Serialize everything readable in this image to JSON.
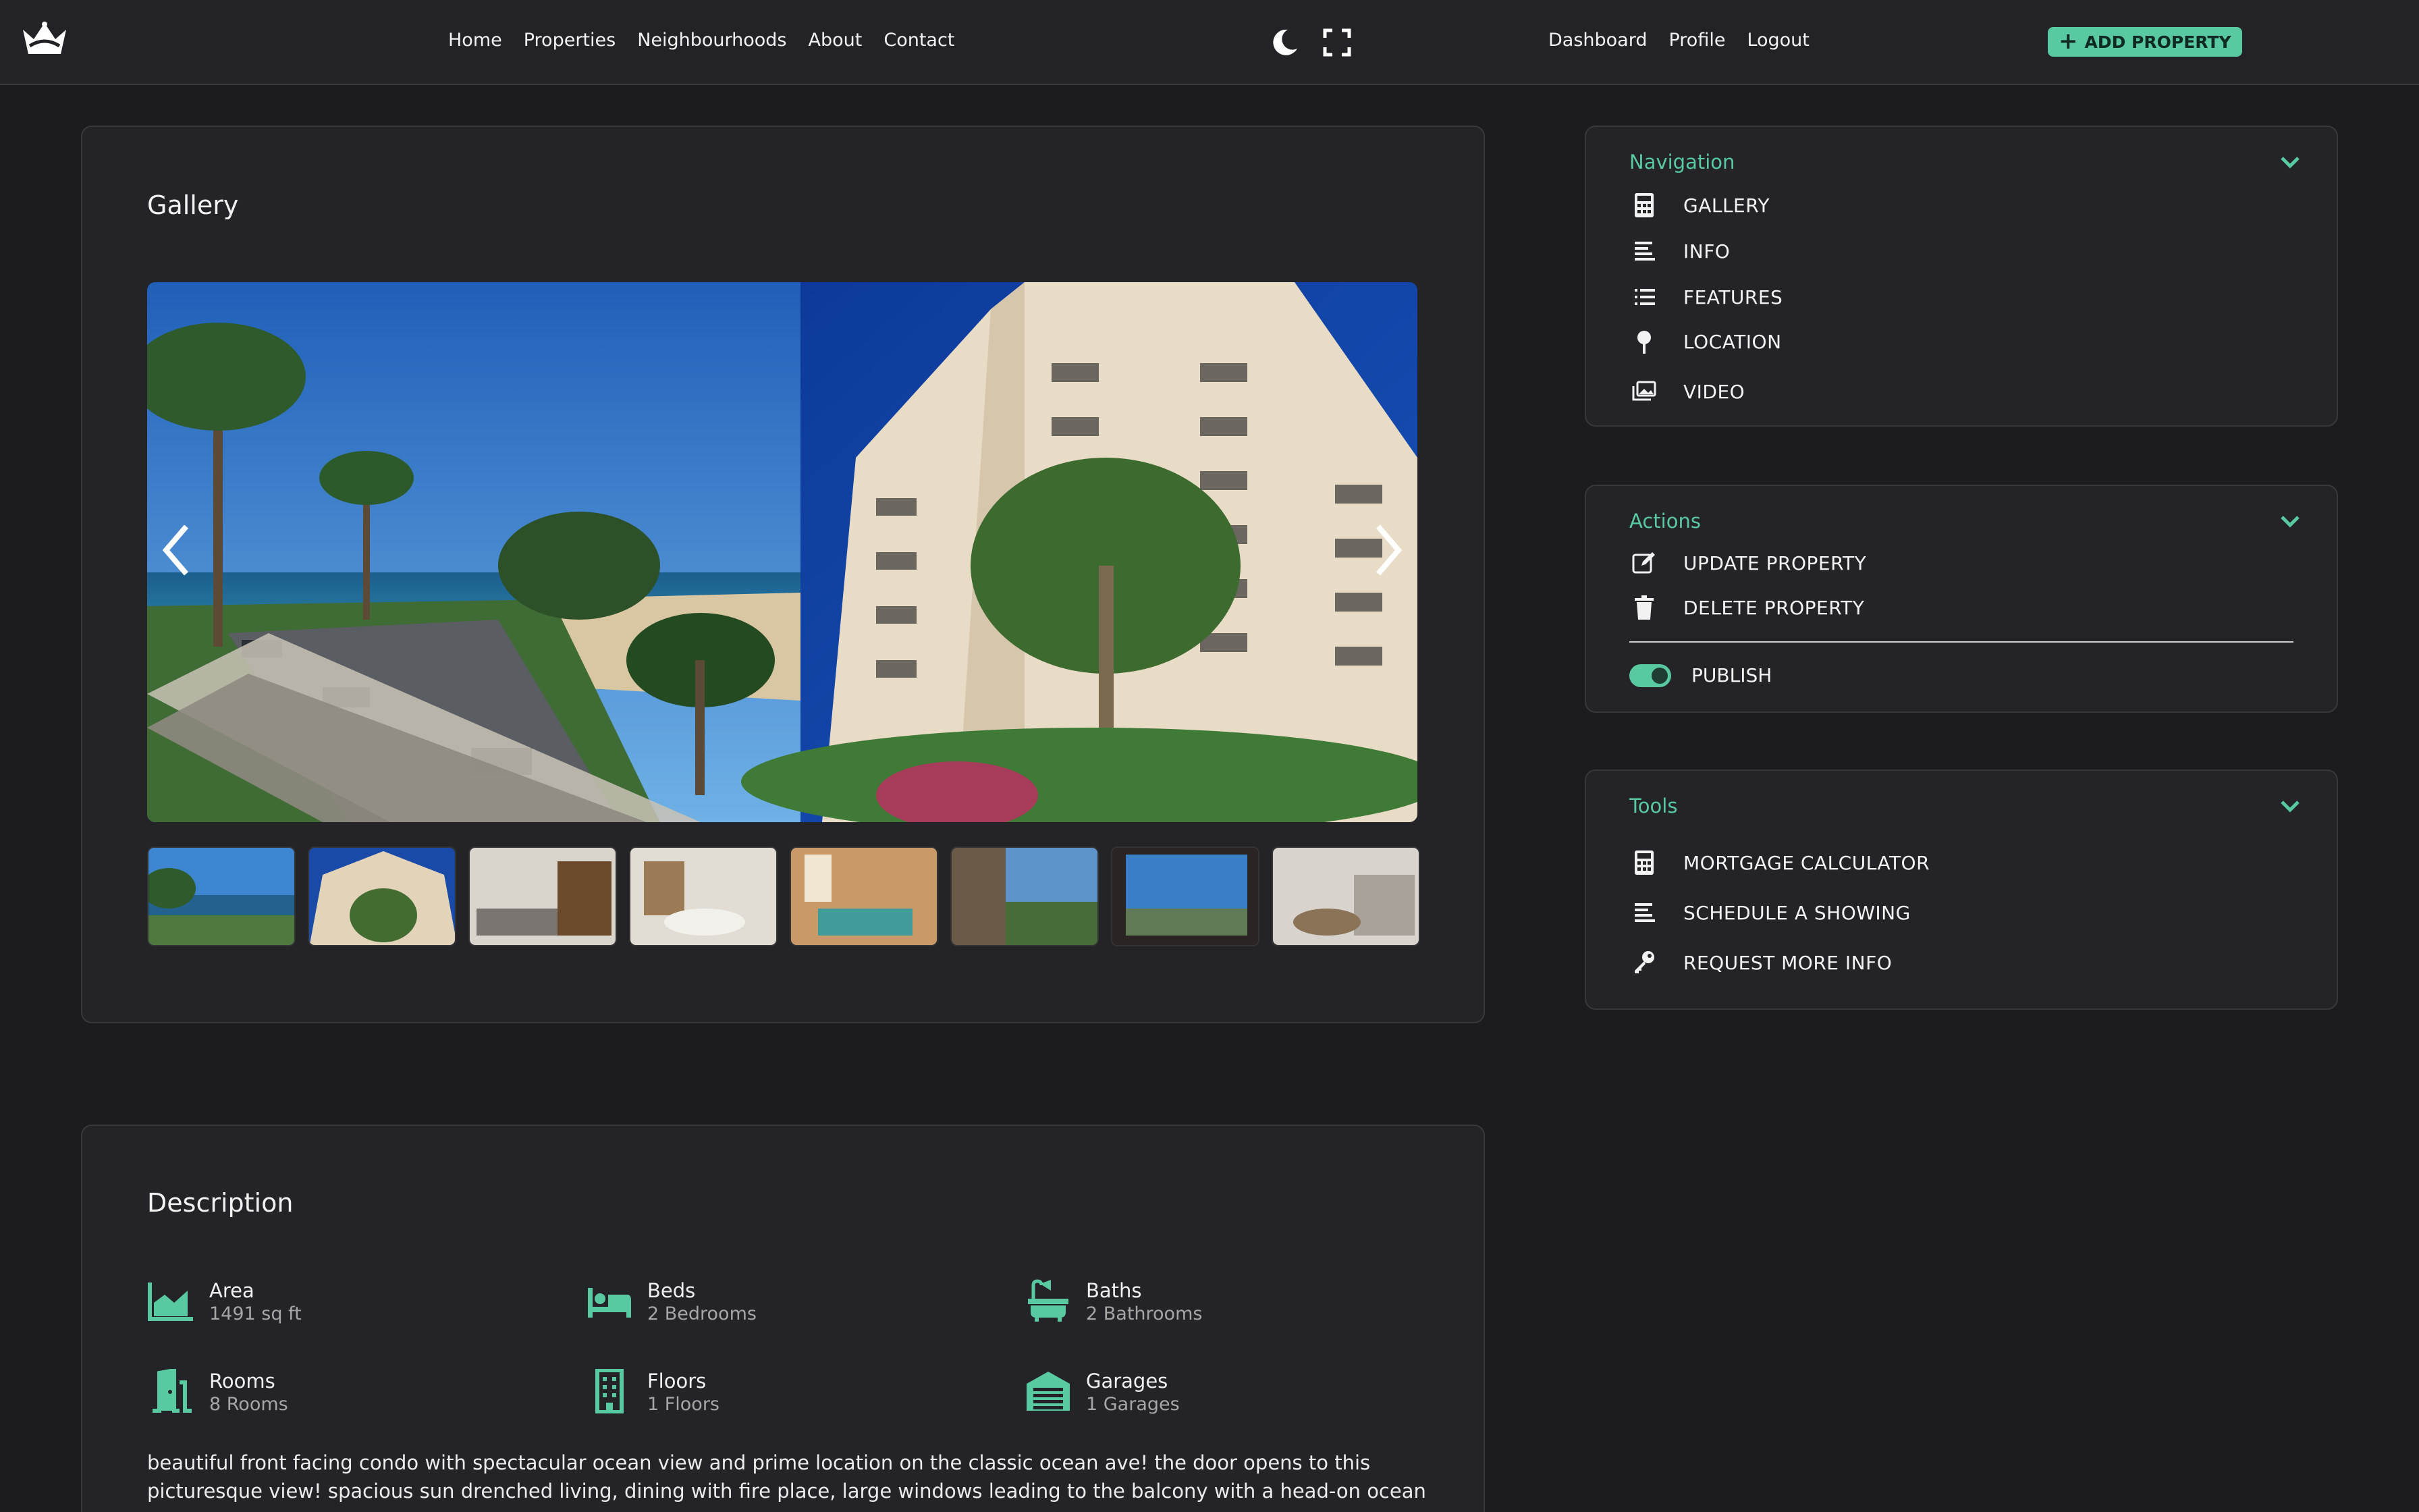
{
  "header": {
    "logo_icon": "crown-icon",
    "nav": [
      "Home",
      "Properties",
      "Neighbourhoods",
      "About",
      "Contact"
    ],
    "theme_icon": "moon-icon",
    "fullscreen_icon": "fullscreen-icon",
    "user_nav": [
      "Dashboard",
      "Profile",
      "Logout"
    ],
    "add_property_label": "ADD PROPERTY"
  },
  "gallery": {
    "title": "Gallery",
    "thumbnail_count": 8
  },
  "sidebar": {
    "navigation": {
      "title": "Navigation",
      "items": [
        {
          "label": "GALLERY",
          "icon": "calculator-icon"
        },
        {
          "label": "INFO",
          "icon": "align-left-icon"
        },
        {
          "label": "FEATURES",
          "icon": "list-icon"
        },
        {
          "label": "LOCATION",
          "icon": "pin-icon"
        },
        {
          "label": "VIDEO",
          "icon": "images-icon"
        }
      ]
    },
    "actions": {
      "title": "Actions",
      "items": [
        {
          "label": "UPDATE PROPERTY",
          "icon": "edit-icon"
        },
        {
          "label": "DELETE PROPERTY",
          "icon": "trash-icon"
        }
      ],
      "publish_label": "PUBLISH",
      "publish_on": true
    },
    "tools": {
      "title": "Tools",
      "items": [
        {
          "label": "MORTGAGE CALCULATOR",
          "icon": "calculator-icon"
        },
        {
          "label": "SCHEDULE A SHOWING",
          "icon": "align-left-icon"
        },
        {
          "label": "REQUEST MORE INFO",
          "icon": "key-icon"
        }
      ]
    }
  },
  "description": {
    "title": "Description",
    "features": [
      {
        "name": "Area",
        "value": "1491 sq ft",
        "icon": "area-chart-icon"
      },
      {
        "name": "Beds",
        "value": "2 Bedrooms",
        "icon": "bed-icon"
      },
      {
        "name": "Baths",
        "value": "2 Bathrooms",
        "icon": "bath-icon"
      },
      {
        "name": "Rooms",
        "value": "8 Rooms",
        "icon": "door-icon"
      },
      {
        "name": "Floors",
        "value": "1 Floors",
        "icon": "building-icon"
      },
      {
        "name": "Garages",
        "value": "1 Garages",
        "icon": "garage-icon"
      }
    ],
    "text": "beautiful front facing condo with spectacular ocean view and prime location on the classic ocean ave! the door opens to this picturesque view! spacious sun drenched living, dining with fire place, large windows leading to the balcony with a head-on ocean"
  },
  "colors": {
    "accent": "#58c9a1",
    "background": "#1c1b1f",
    "card": "#242327"
  }
}
